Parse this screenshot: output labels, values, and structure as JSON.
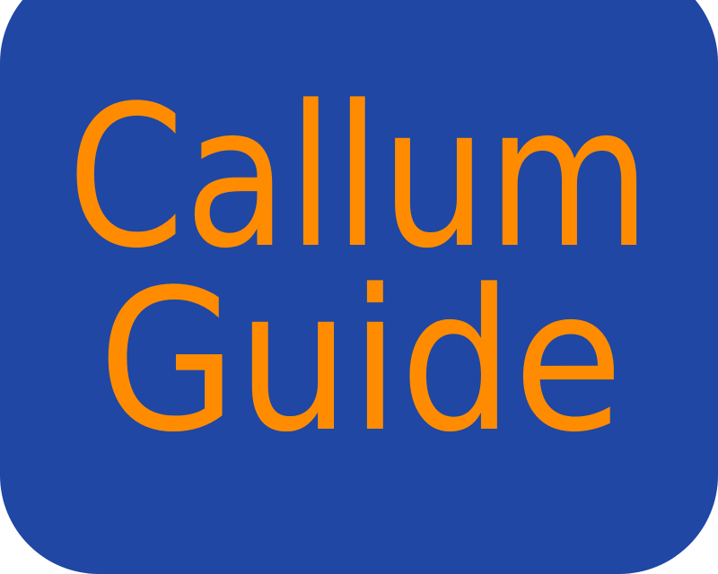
{
  "logo": {
    "line1": "Callum",
    "line2": "Guide",
    "colors": {
      "background": "#1f47a3",
      "text": "#ff8c00"
    }
  }
}
